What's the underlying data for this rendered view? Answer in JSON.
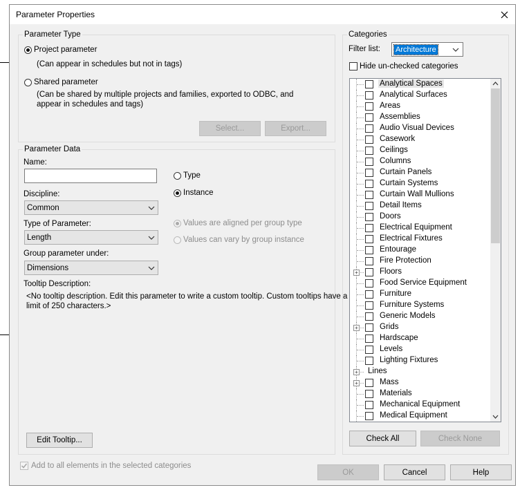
{
  "dialog": {
    "title": "Parameter Properties"
  },
  "parameter_type": {
    "legend": "Parameter Type",
    "project_label": "Project parameter",
    "project_desc": "(Can appear in schedules but not in tags)",
    "shared_label": "Shared parameter",
    "shared_desc_line1": "(Can be shared by multiple projects and families, exported to ODBC, and",
    "shared_desc_line2": "appear in schedules and tags)",
    "select_label": "Select...",
    "export_label": "Export...",
    "selected": "project"
  },
  "parameter_data": {
    "legend": "Parameter Data",
    "name_label": "Name:",
    "name_value": "",
    "discipline_label": "Discipline:",
    "discipline_value": "Common",
    "type_label": "Type of Parameter:",
    "type_value": "Length",
    "group_label": "Group parameter under:",
    "group_value": "Dimensions",
    "type_radio": "Type",
    "instance_radio": "Instance",
    "aligned_radio": "Values are aligned per group type",
    "vary_radio": "Values can vary by group instance",
    "tooltip_label": "Tooltip Description:",
    "tooltip_line1": "<No tooltip description. Edit this parameter to write a custom tooltip. Custom tooltips have a",
    "tooltip_line2": "limit of 250 characters.>",
    "edit_tooltip_label": "Edit Tooltip..."
  },
  "categories": {
    "legend": "Categories",
    "filter_label": "Filter list:",
    "filter_value": "Architecture",
    "hide_label": "Hide un-checked categories",
    "items": [
      {
        "label": "Analytical Spaces",
        "checkbox": true,
        "expandable": false,
        "selected": true
      },
      {
        "label": "Analytical Surfaces",
        "checkbox": true,
        "expandable": false
      },
      {
        "label": "Areas",
        "checkbox": true,
        "expandable": false
      },
      {
        "label": "Assemblies",
        "checkbox": true,
        "expandable": false
      },
      {
        "label": "Audio Visual Devices",
        "checkbox": true,
        "expandable": false
      },
      {
        "label": "Casework",
        "checkbox": true,
        "expandable": false
      },
      {
        "label": "Ceilings",
        "checkbox": true,
        "expandable": false
      },
      {
        "label": "Columns",
        "checkbox": true,
        "expandable": false
      },
      {
        "label": "Curtain Panels",
        "checkbox": true,
        "expandable": false
      },
      {
        "label": "Curtain Systems",
        "checkbox": true,
        "expandable": false
      },
      {
        "label": "Curtain Wall Mullions",
        "checkbox": true,
        "expandable": false
      },
      {
        "label": "Detail Items",
        "checkbox": true,
        "expandable": false
      },
      {
        "label": "Doors",
        "checkbox": true,
        "expandable": false
      },
      {
        "label": "Electrical Equipment",
        "checkbox": true,
        "expandable": false
      },
      {
        "label": "Electrical Fixtures",
        "checkbox": true,
        "expandable": false
      },
      {
        "label": "Entourage",
        "checkbox": true,
        "expandable": false
      },
      {
        "label": "Fire Protection",
        "checkbox": true,
        "expandable": false
      },
      {
        "label": "Floors",
        "checkbox": true,
        "expandable": true
      },
      {
        "label": "Food Service Equipment",
        "checkbox": true,
        "expandable": false
      },
      {
        "label": "Furniture",
        "checkbox": true,
        "expandable": false
      },
      {
        "label": "Furniture Systems",
        "checkbox": true,
        "expandable": false
      },
      {
        "label": "Generic Models",
        "checkbox": true,
        "expandable": false
      },
      {
        "label": "Grids",
        "checkbox": true,
        "expandable": true
      },
      {
        "label": "Hardscape",
        "checkbox": true,
        "expandable": false
      },
      {
        "label": "Levels",
        "checkbox": true,
        "expandable": false
      },
      {
        "label": "Lighting Fixtures",
        "checkbox": true,
        "expandable": false
      },
      {
        "label": "Lines",
        "checkbox": false,
        "expandable": true
      },
      {
        "label": "Mass",
        "checkbox": true,
        "expandable": true
      },
      {
        "label": "Materials",
        "checkbox": true,
        "expandable": false
      },
      {
        "label": "Mechanical Equipment",
        "checkbox": true,
        "expandable": false
      },
      {
        "label": "Medical Equipment",
        "checkbox": true,
        "expandable": false
      }
    ],
    "check_all_label": "Check All",
    "check_none_label": "Check None"
  },
  "footer": {
    "add_all_label": "Add to all elements in the selected categories",
    "ok_label": "OK",
    "cancel_label": "Cancel",
    "help_label": "Help"
  },
  "icons": {
    "close": "close-icon",
    "dropdown": "chevron-down-icon",
    "expander": "plus-expander-icon"
  },
  "colors": {
    "selection": "#0078d7",
    "dialog_bg": "#f0f0f0"
  }
}
